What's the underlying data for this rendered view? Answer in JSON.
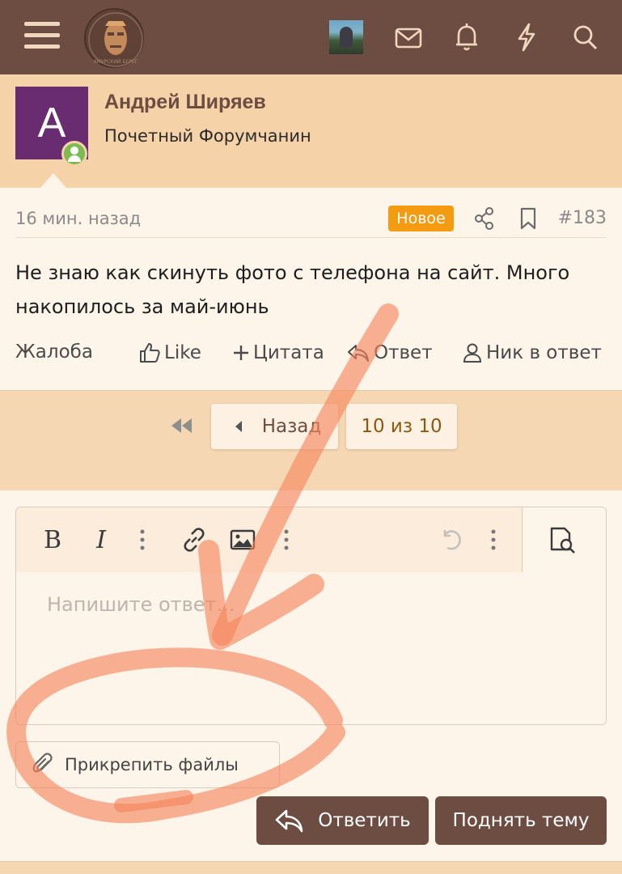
{
  "header": {
    "logo_text": "АМУРСКИЙ БЕРЕГ",
    "icons": [
      "menu-icon",
      "logo",
      "user-avatar",
      "mail-icon",
      "bell-icon",
      "lightning-icon",
      "search-icon"
    ]
  },
  "post": {
    "author": {
      "avatar_letter": "А",
      "avatar_color": "#6a2c70",
      "name": "Андрей Ширяев",
      "title": "Почетный Форумчанин"
    },
    "timestamp": "16 мин. назад",
    "new_badge": "Новое",
    "number": "#183",
    "text": "Не знаю как скинуть фото с телефона на сайт. Много накопилось за май-июнь",
    "actions": {
      "report": "Жалоба",
      "like": "Like",
      "quote": "Цитата",
      "reply": "Ответ",
      "mention": "Ник в ответ"
    }
  },
  "pagination": {
    "prev_label": "Назад",
    "current": "10 из 10"
  },
  "editor": {
    "placeholder": "Напишите ответ...",
    "toolbar": {
      "bold": "B",
      "italic": "I"
    },
    "attach_label": "Прикрепить файлы",
    "reply_button": "Ответить",
    "bump_button": "Поднять тему"
  },
  "colors": {
    "header_bg": "#6d4c41",
    "accent_badge": "#f39c12",
    "annotation_stroke": "#f5845a"
  }
}
